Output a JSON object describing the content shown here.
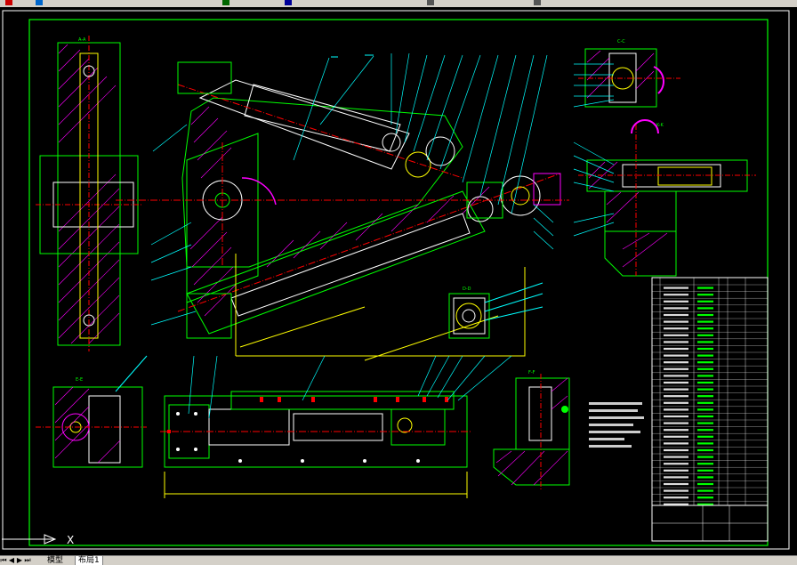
{
  "colors": {
    "background": "#000000",
    "frame": "#00ff00",
    "section": "#ff00ff",
    "axis": "#ff0000",
    "leader": "#00ffff",
    "geometry": "#ffffff",
    "dimension": "#ffff00"
  },
  "toolbar": {
    "icons": [
      "undo-icon",
      "redo-icon",
      "zoom-icon",
      "pan-icon",
      "layer-icon",
      "properties-icon"
    ]
  },
  "drawing": {
    "section_labels": {
      "aa": "A-A",
      "bb": "B-B",
      "cc": "C-C",
      "dd": "D-D",
      "ee": "E-E",
      "ff": "F-F",
      "kk": "K-K"
    }
  },
  "ucs": {
    "x_label": "X"
  },
  "statusbar": {
    "tabs": [
      {
        "label": "模型",
        "active": false
      },
      {
        "label": "布局1",
        "active": true
      }
    ]
  }
}
